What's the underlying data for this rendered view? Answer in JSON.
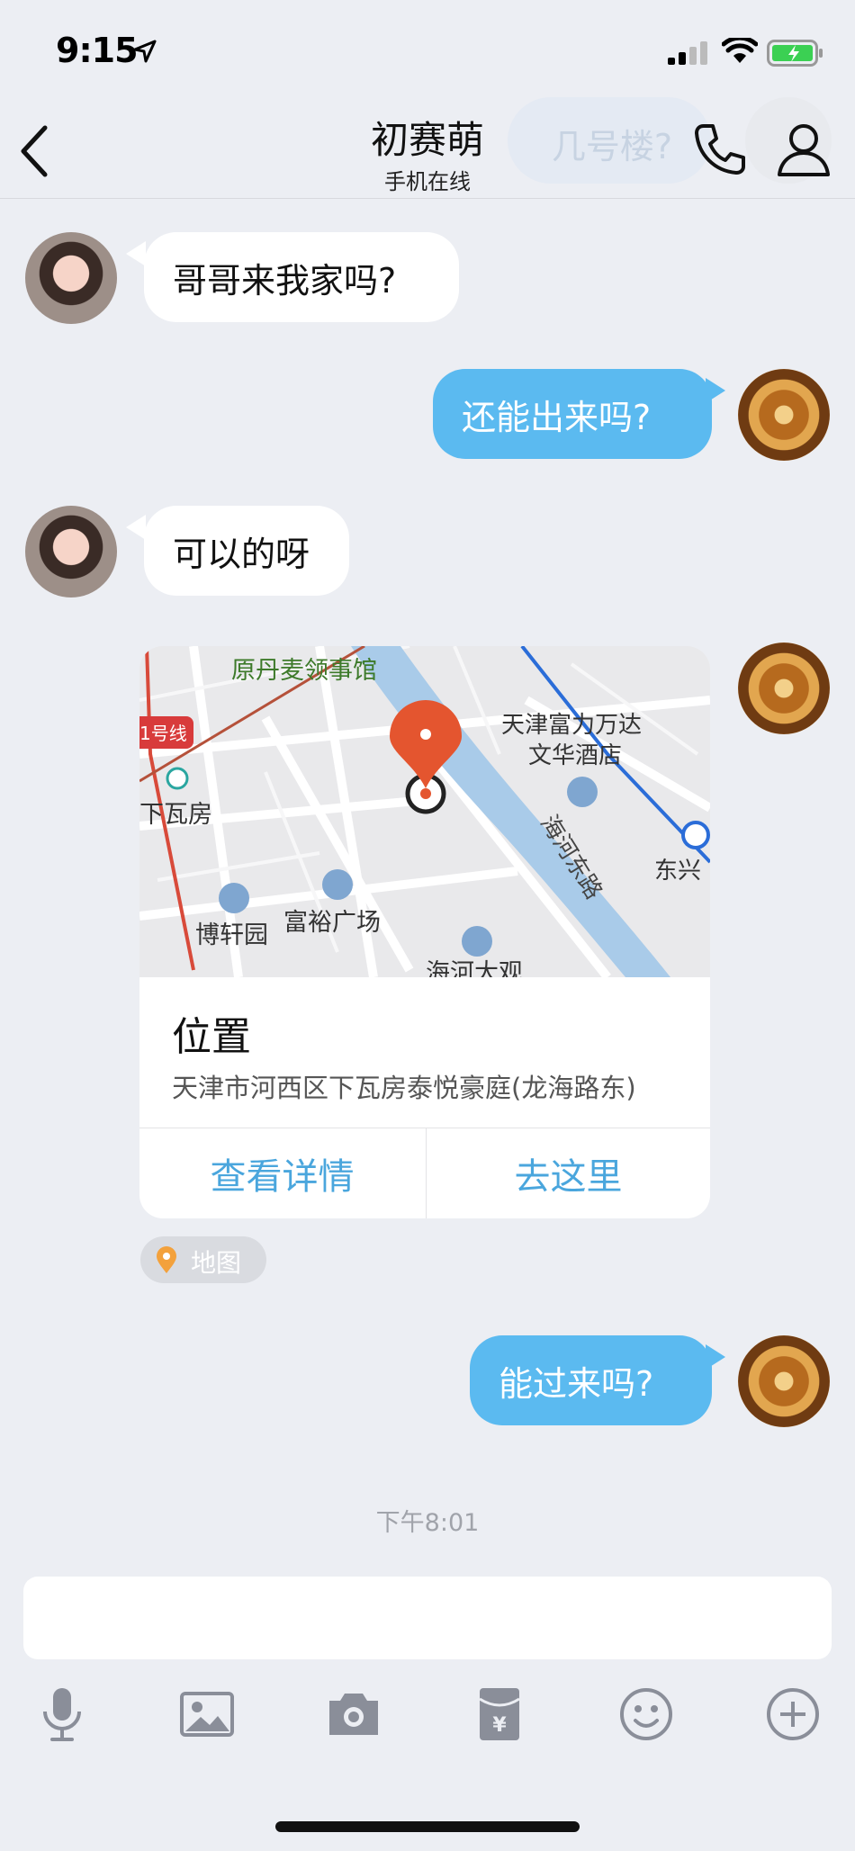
{
  "status_bar": {
    "time": "9:15"
  },
  "header": {
    "title": "初赛萌",
    "subtitle": "手机在线",
    "ghost_text": "几号楼?"
  },
  "messages": [
    {
      "direction": "in",
      "text": "哥哥来我家吗?"
    },
    {
      "direction": "out",
      "text": "还能出来吗?"
    },
    {
      "direction": "in",
      "text": "可以的呀"
    },
    {
      "direction": "out",
      "type": "location",
      "title": "位置",
      "address": "天津市河西区下瓦房泰悦豪庭(龙海路东)",
      "button_details": "查看详情",
      "button_go": "去这里",
      "chip": "地图",
      "map_labels": {
        "consulate": "原丹麦领事馆",
        "line1": "1号线",
        "xiawafang": "下瓦房",
        "hotel_line1": "天津富力万达",
        "hotel_line2": "文华酒店",
        "river_road": "海河东路",
        "dongxing": "东兴",
        "boxuan": "博轩园",
        "fuyu": "富裕广场",
        "haihe": "海河大观"
      }
    },
    {
      "direction": "out",
      "text": "能过来吗?"
    }
  ],
  "timestamp": "下午8:01",
  "toolbar": [
    "mic-icon",
    "image-icon",
    "camera-icon",
    "red-packet-icon",
    "emoji-icon",
    "plus-icon"
  ],
  "colors": {
    "outgoing": "#5bbaf0",
    "incoming": "#ffffff",
    "background": "#eceef3",
    "link": "#4aa6dd",
    "pin": "#e4552f"
  }
}
